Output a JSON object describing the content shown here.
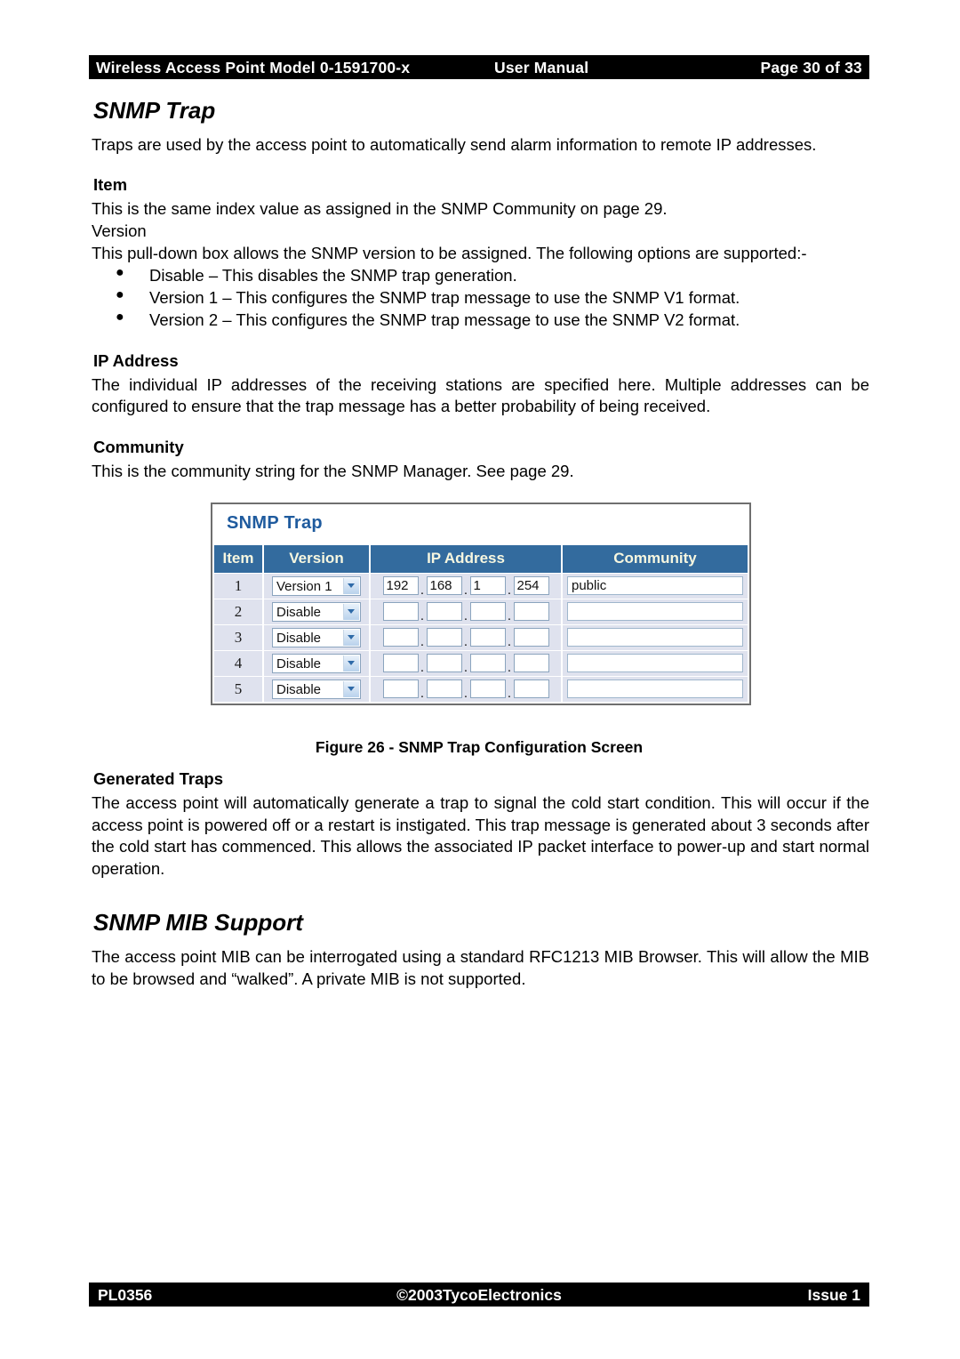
{
  "header": {
    "left": "Wireless Access Point  Model 0-1591700-x",
    "middle": "User Manual",
    "right": "Page 30 of 33"
  },
  "footer": {
    "left": "PL0356",
    "middle": "©2003TycoElectronics",
    "right": "Issue 1"
  },
  "sections": {
    "snmp_trap": {
      "heading": "SNMP Trap",
      "intro": "Traps are used by the access point to automatically send alarm information to remote IP addresses.",
      "item_heading": "Item",
      "item_text": "This is the same index value as assigned in the SNMP Community on page 29.",
      "version_label": "Version",
      "version_text": "This pull-down box allows the SNMP version to be assigned. The following options are supported:-",
      "bullets": [
        "Disable – This disables the SNMP trap generation.",
        "Version 1 – This configures the SNMP trap message to use the SNMP V1 format.",
        "Version 2 – This configures the SNMP trap message to use the SNMP V2 format."
      ],
      "ip_heading": "IP Address",
      "ip_text": "The individual IP addresses of the receiving stations are specified here. Multiple addresses can be configured to ensure that the trap message has a better probability of being received.",
      "community_heading": "Community",
      "community_text": "This is the community string for the SNMP Manager. See page 29."
    },
    "generated_traps": {
      "heading": "Generated Traps",
      "text": "The access point will automatically generate a trap to signal the cold start condition. This will occur if the access point is powered off or a restart is instigated. This trap message is generated about 3 seconds after the cold start has commenced. This allows the associated IP packet interface to power-up and start normal operation."
    },
    "snmp_mib": {
      "heading": "SNMP MIB Support",
      "text": "The access point MIB can be interrogated using a standard RFC1213 MIB Browser. This will allow the MIB to be browsed and “walked”. A private MIB is not supported."
    }
  },
  "figure": {
    "caption": "Figure 26 - SNMP Trap Configuration Screen",
    "panel_title": "SNMP Trap",
    "columns": [
      "Item",
      "Version",
      "IP Address",
      "Community"
    ],
    "colors": {
      "header_band": "#336b9e",
      "header_text": "#f7f7e0",
      "row_bg": "#dfe2ee",
      "title_text": "#1f5b9e",
      "field_border": "#8ba4be"
    },
    "rows": [
      {
        "item": "1",
        "version": "Version 1",
        "ip": [
          "192",
          "168",
          "1",
          "254"
        ],
        "community": "public"
      },
      {
        "item": "2",
        "version": "Disable",
        "ip": [
          "",
          "",
          "",
          ""
        ],
        "community": ""
      },
      {
        "item": "3",
        "version": "Disable",
        "ip": [
          "",
          "",
          "",
          ""
        ],
        "community": ""
      },
      {
        "item": "4",
        "version": "Disable",
        "ip": [
          "",
          "",
          "",
          ""
        ],
        "community": ""
      },
      {
        "item": "5",
        "version": "Disable",
        "ip": [
          "",
          "",
          "",
          ""
        ],
        "community": ""
      }
    ],
    "separator": ".",
    "dropdown_icon": "chevron-down-icon"
  }
}
